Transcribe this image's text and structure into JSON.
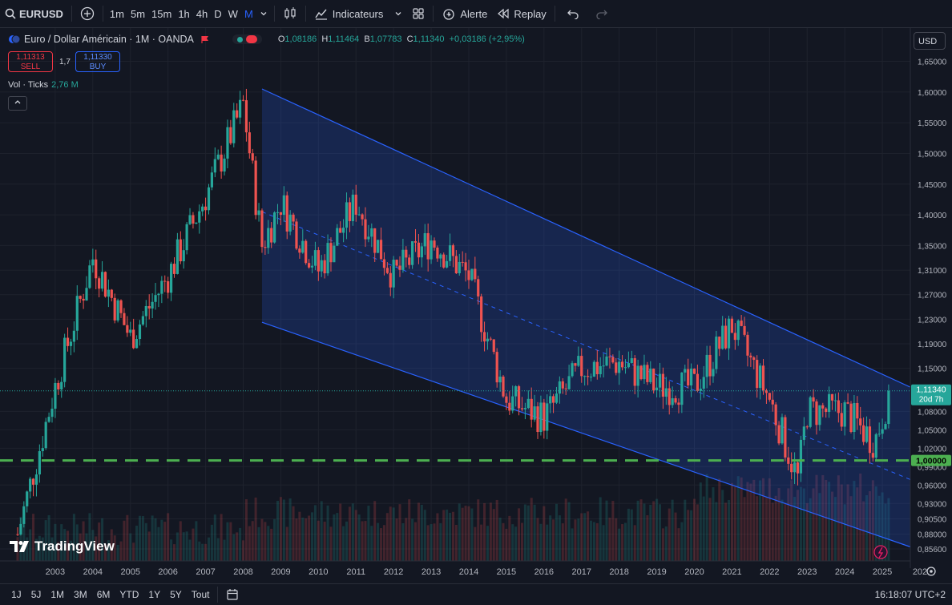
{
  "toolbar": {
    "symbol": "EURUSD",
    "timeframes": [
      "1m",
      "5m",
      "15m",
      "1h",
      "4h",
      "D",
      "W",
      "M"
    ],
    "active_timeframe": "M",
    "indicators_label": "Indicateurs",
    "alert_label": "Alerte",
    "replay_label": "Replay"
  },
  "legend": {
    "title": "Euro / Dollar Américain · 1M · OANDA",
    "o_label": "O",
    "o": "1,08186",
    "h_label": "H",
    "h": "1,11464",
    "b_label": "B",
    "b": "1,07783",
    "c_label": "C",
    "c": "1,11340",
    "change": "+0,03186 (+2,95%)"
  },
  "trade": {
    "sell_price": "1,11313",
    "sell_label": "SELL",
    "spread": "1,7",
    "buy_price": "1,11330",
    "buy_label": "BUY"
  },
  "volume": {
    "label": "Vol · Ticks",
    "value": "2,76 M"
  },
  "currency": "USD",
  "price_scale": [
    "1,65000",
    "1,60000",
    "1,55000",
    "1,50000",
    "1,45000",
    "1,40000",
    "1,35000",
    "1,31000",
    "1,27000",
    "1,23000",
    "1,19000",
    "1,15000",
    "1,08000",
    "1,05000",
    "1,02000",
    "0,99000",
    "0,96000",
    "0,93000",
    "0,90500",
    "0,88000",
    "0,85600"
  ],
  "current_price": {
    "value": "1,11340",
    "countdown": "20d 7h"
  },
  "level_label": "1,00000",
  "time_axis": [
    "2003",
    "2004",
    "2005",
    "2006",
    "2007",
    "2008",
    "2009",
    "2010",
    "2011",
    "2012",
    "2013",
    "2014",
    "2015",
    "2016",
    "2017",
    "2018",
    "2019",
    "2020",
    "2021",
    "2022",
    "2023",
    "2024",
    "2025",
    "202"
  ],
  "ranges": [
    "1J",
    "5J",
    "1M",
    "3M",
    "6M",
    "YTD",
    "1Y",
    "5Y",
    "Tout"
  ],
  "clock": "16:18:07 UTC+2",
  "brand": "TradingView",
  "colors": {
    "up": "#26a69a",
    "down": "#ef5350",
    "channel": "#2962ff",
    "level": "#4caf50",
    "accent": "#2962ff"
  },
  "chart_data": {
    "type": "candlestick",
    "symbol": "EURUSD",
    "interval": "1M",
    "price_scale": "linear",
    "x": [
      "2002",
      "2003",
      "2004",
      "2005",
      "2006",
      "2007",
      "2008",
      "2008.5",
      "2009",
      "2010",
      "2011",
      "2012",
      "2013",
      "2014",
      "2015",
      "2016",
      "2017",
      "2018",
      "2019",
      "2020",
      "2021",
      "2022",
      "2022.75",
      "2023",
      "2024",
      "2024.8",
      "2025.2"
    ],
    "close": [
      0.88,
      1.12,
      1.33,
      1.2,
      1.3,
      1.43,
      1.58,
      1.35,
      1.42,
      1.31,
      1.42,
      1.3,
      1.36,
      1.3,
      1.1,
      1.07,
      1.15,
      1.16,
      1.12,
      1.12,
      1.22,
      1.1,
      0.97,
      1.08,
      1.08,
      1.03,
      1.1134
    ],
    "ylim": [
      0.856,
      1.665
    ],
    "xlim": [
      "2002",
      "2026"
    ],
    "channel": {
      "upper": [
        [
          "2008.5",
          1.605
        ],
        [
          "2025.9",
          1.115
        ]
      ],
      "lower": [
        [
          "2008.5",
          1.225
        ],
        [
          "2025.9",
          0.856
        ]
      ],
      "mid": [
        [
          "2008.5",
          1.405
        ],
        [
          "2025.9",
          0.965
        ]
      ]
    },
    "horizontal_level": 1.0,
    "last_price": 1.1134
  }
}
